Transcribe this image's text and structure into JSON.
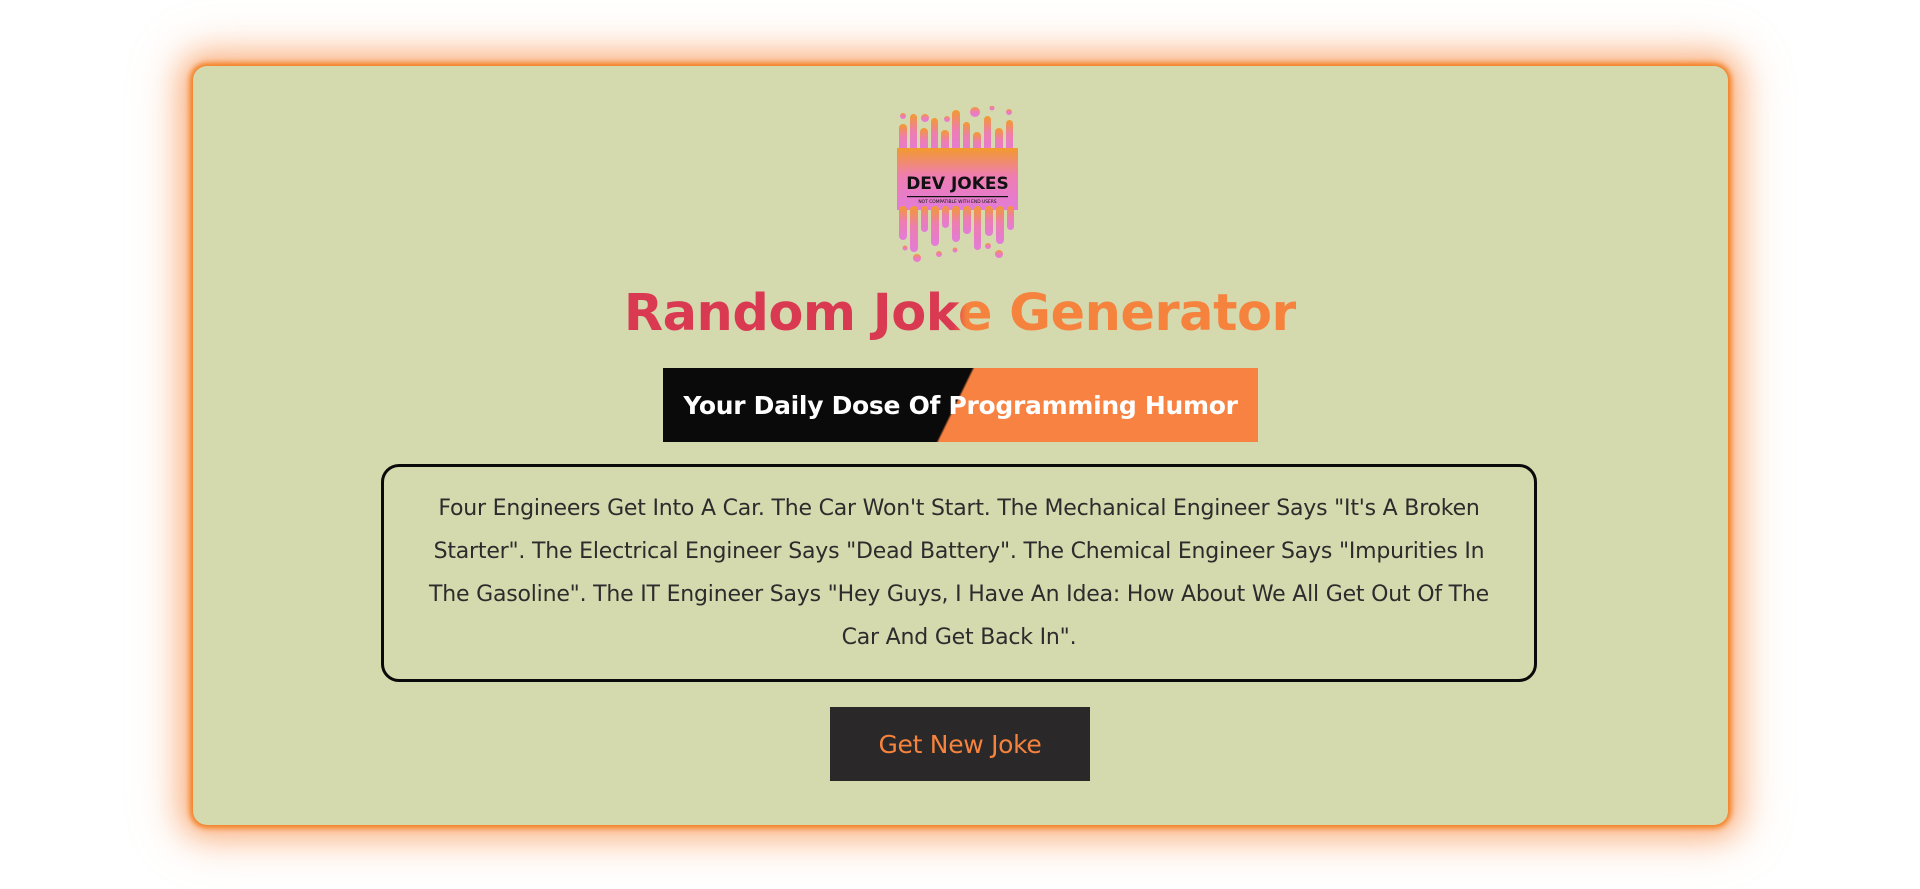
{
  "logo": {
    "title": "DEV JOKES",
    "tagline": "NOT COMPATIBLE WITH END USERS",
    "colors": {
      "top": "#f29a2e",
      "middle": "#ee7db0",
      "bottom": "#e27cd9"
    }
  },
  "header": {
    "title": "Random Joke Generator",
    "subtitle": "Your Daily Dose Of Programming Humor"
  },
  "joke": {
    "text": "Four Engineers Get Into A Car. The Car Won't Start. The Mechanical Engineer Says \"It's A Broken Starter\". The Electrical Engineer Says \"Dead Battery\". The Chemical Engineer Says \"Impurities In The Gasoline\". The IT Engineer Says \"Hey Guys, I Have An Idea: How About We All Get Out Of The Car And Get Back In\"."
  },
  "actions": {
    "new_joke_label": "Get New Joke"
  },
  "colors": {
    "card_background": "#d5d9ae",
    "glow": "#f27a1a",
    "title_left": "#d93a52",
    "title_right": "#f5833e",
    "banner_left": "#0a0a0a",
    "banner_right": "#f78242",
    "button_background": "#2a2828",
    "button_text": "#f5833e"
  }
}
